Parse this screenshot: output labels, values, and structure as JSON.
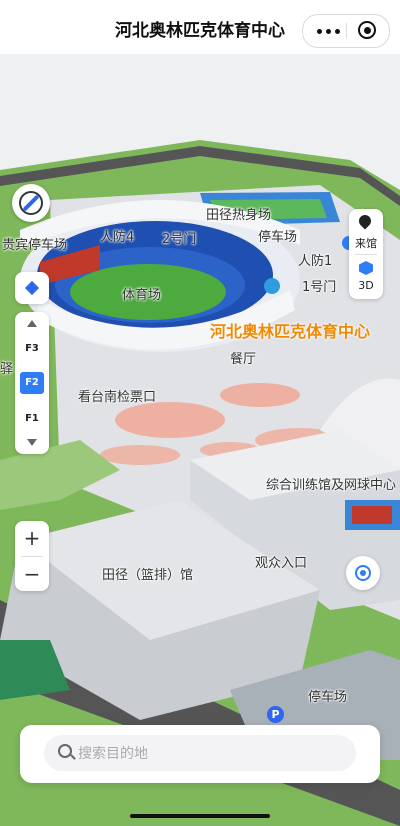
{
  "header": {
    "title": "河北奥林匹克体育中心"
  },
  "map_labels": {
    "tianjing_re_shen": "田径热身场",
    "guibin_parking": "贵宾停车场",
    "renfang4": "人防4",
    "gate2": "2号门",
    "parking_north": "停车场",
    "renfang1": "人防1",
    "gate1": "1号门",
    "stadium": "体育场",
    "center_name": "河北奥林匹克体育中心",
    "restaurant": "餐厅",
    "south_ticket": "看台南检票口",
    "training_hall": "综合训练馆及网球中心",
    "audience_entrance": "观众入口",
    "track_hall": "田径（篮排）馆",
    "parking_south": "停车场",
    "left_cut": "驿"
  },
  "controls": {
    "floors": [
      "F3",
      "F2",
      "F1"
    ],
    "active_floor": "F2",
    "zoom_in": "+",
    "zoom_out": "−",
    "visit_label": "来馆",
    "view_mode": "3D"
  },
  "search": {
    "placeholder": "搜索目的地"
  },
  "colors": {
    "accent": "#2f7df6",
    "center_label": "#f08a00"
  }
}
